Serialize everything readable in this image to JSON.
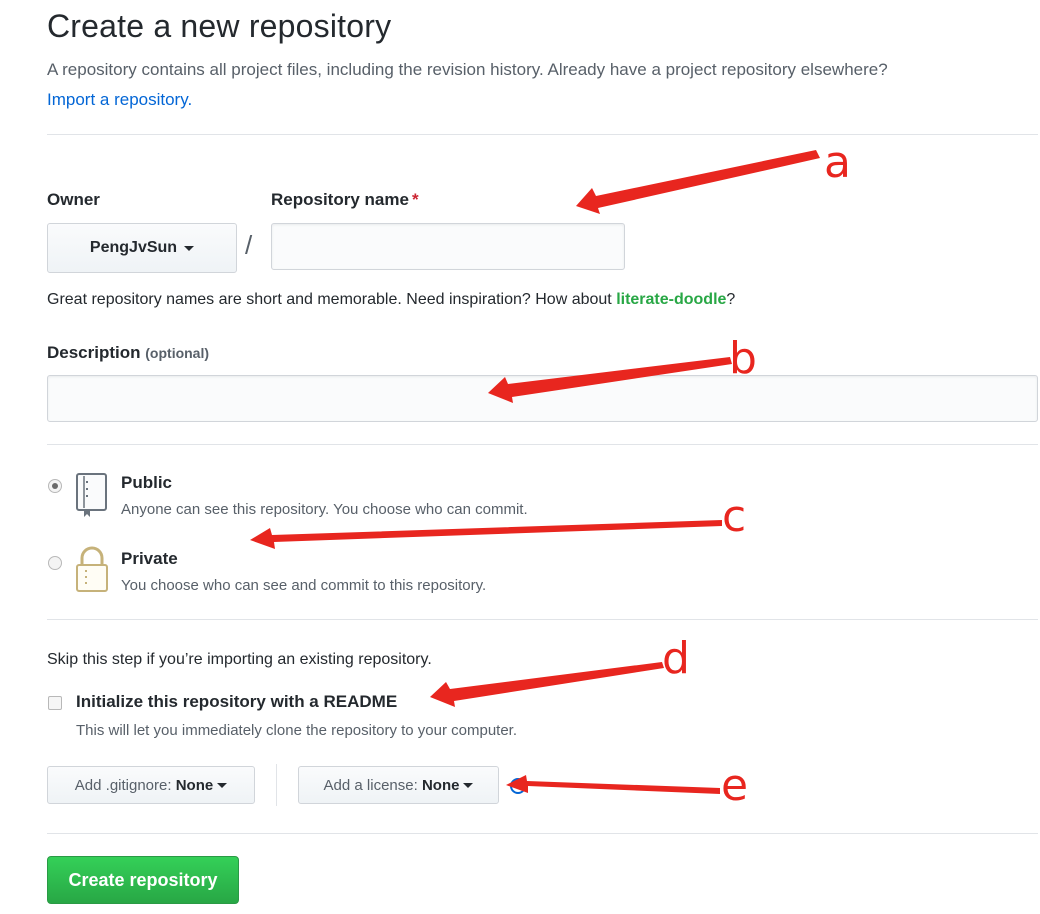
{
  "page": {
    "title": "Create a new repository",
    "lead": "A repository contains all project files, including the revision history. Already have a project repository elsewhere?",
    "import_link": "Import a repository."
  },
  "owner": {
    "label": "Owner",
    "value": "PengJvSun"
  },
  "slash": "/",
  "repo_name": {
    "label": "Repository name",
    "required_mark": "*",
    "value": ""
  },
  "suggestion": {
    "text": "Great repository names are short and memorable. Need inspiration? How about",
    "name": "literate-doodle",
    "end": "?"
  },
  "description": {
    "label": "Description",
    "optional": "(optional)",
    "value": ""
  },
  "visibility": {
    "public": {
      "label": "Public",
      "desc": "Anyone can see this repository. You choose who can commit.",
      "selected": true
    },
    "private": {
      "label": "Private",
      "desc": "You choose who can see and commit to this repository.",
      "selected": false
    }
  },
  "init": {
    "skip_note": "Skip this step if you’re importing an existing repository.",
    "readme_label": "Initialize this repository with a README",
    "readme_desc": "This will let you immediately clone the repository to your computer.",
    "readme_checked": false
  },
  "gitignore": {
    "prefix": "Add .gitignore:",
    "value": "None"
  },
  "license": {
    "prefix": "Add a license:",
    "value": "None"
  },
  "submit_label": "Create repository",
  "annotations": [
    "a",
    "b",
    "c",
    "d",
    "e"
  ],
  "colors": {
    "accent": "#0366d6",
    "primary_button": "#2ea44f",
    "annotation_red": "#e8261f"
  }
}
